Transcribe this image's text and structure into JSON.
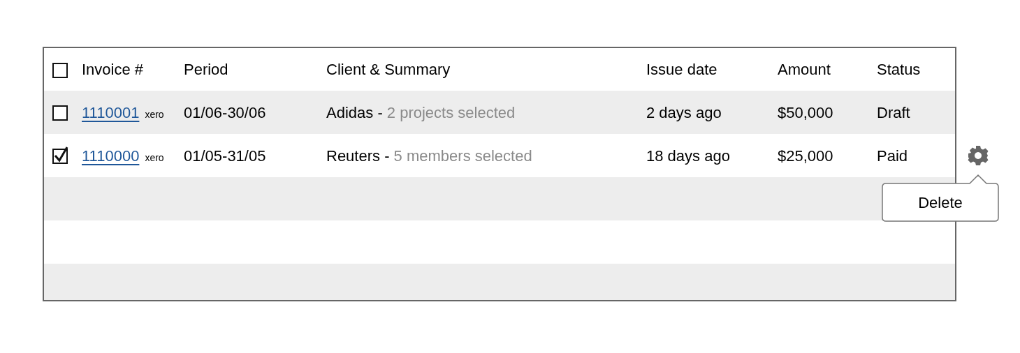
{
  "table": {
    "header_checkbox": {
      "checked": false
    },
    "columns": [
      "Invoice #",
      "Period",
      "Client & Summary",
      "Issue date",
      "Amount",
      "Status"
    ],
    "rows": [
      {
        "checked": false,
        "invoice": "1110001",
        "source": "xero",
        "period": "01/06-30/06",
        "client": "Adidas -",
        "summary": "2 projects selected",
        "issue_date": "2 days ago",
        "amount": "$50,000",
        "status": "Draft",
        "show_actions": false
      },
      {
        "checked": true,
        "invoice": "1110000",
        "source": "xero",
        "period": "01/05-31/05",
        "client": "Reuters -",
        "summary": "5 members selected",
        "issue_date": "18 days ago",
        "amount": "$25,000",
        "status": "Paid",
        "show_actions": true
      }
    ]
  },
  "actions_menu": {
    "items": [
      "Delete"
    ]
  }
}
